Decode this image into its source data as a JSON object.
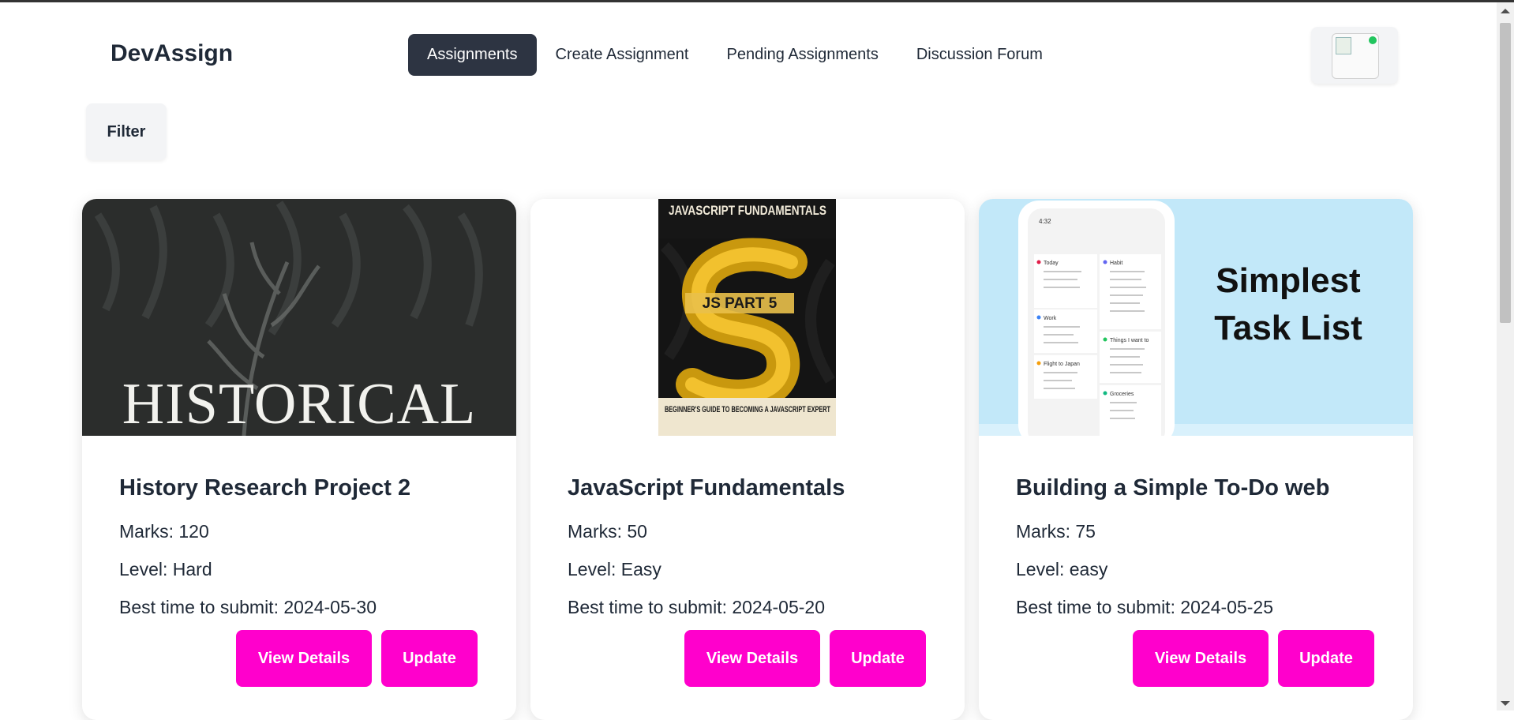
{
  "brand": "DevAssign",
  "nav": [
    {
      "label": "Assignments",
      "active": true
    },
    {
      "label": "Create Assignment",
      "active": false
    },
    {
      "label": "Pending Assignments",
      "active": false
    },
    {
      "label": "Discussion Forum",
      "active": false
    }
  ],
  "filter_label": "Filter",
  "cards": [
    {
      "image_text": "HISTORICAL",
      "title": "History Research Project 2",
      "marks": "Marks: 120",
      "level": "Level: Hard",
      "best_time": "Best time to submit: 2024-05-30",
      "details_label": "View Details",
      "update_label": "Update"
    },
    {
      "image_text": {
        "top": "JAVASCRIPT FUNDAMENTALS",
        "center": "JS PART 5",
        "bottom": "BEGINNER'S GUIDE TO BECOMING A JAVASCRIPT EXPERT"
      },
      "title": "JavaScript Fundamentals",
      "marks": "Marks: 50",
      "level": "Level: Easy",
      "best_time": "Best time to submit: 2024-05-20",
      "details_label": "View Details",
      "update_label": "Update"
    },
    {
      "image_text": {
        "headline_1": "Simplest",
        "headline_2": "Task List",
        "phone_time": "4:32",
        "lists": [
          "Today",
          "Habit",
          "Work",
          "Things I want to",
          "Flight to Japan",
          "Groceries"
        ]
      },
      "title": "Building a Simple To-Do web",
      "marks": "Marks: 75",
      "level": "Level: easy",
      "best_time": "Best time to submit: 2024-05-25",
      "details_label": "View Details",
      "update_label": "Update"
    }
  ],
  "colors": {
    "nav_active_bg": "#2d3442",
    "button_bg": "#ff00cc",
    "online_dot": "#22c55e"
  }
}
